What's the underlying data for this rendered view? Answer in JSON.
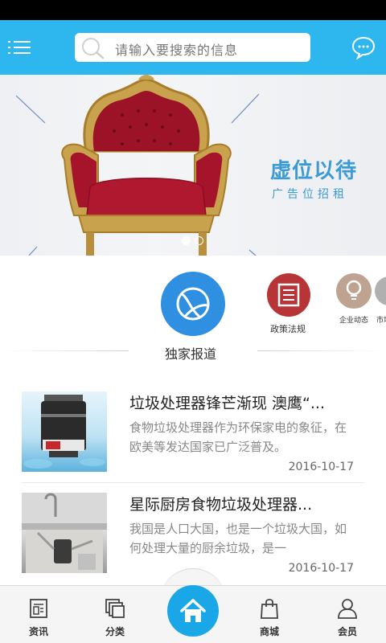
{
  "search": {
    "placeholder": "请输入要搜索的信息"
  },
  "banner": {
    "title": "虚位以待",
    "subtitle": "广告位招租",
    "slide_count": 2,
    "active_slide": 1
  },
  "categories": [
    {
      "label": "",
      "icon": "basketball-icon",
      "color": "#2f8fe0"
    },
    {
      "label": "政策法规",
      "icon": "document-icon",
      "color": "#b73437"
    },
    {
      "label": "企业动态",
      "icon": "lightbulb-icon",
      "color": "#bfa391"
    },
    {
      "label": "市场",
      "icon": "unknown-icon",
      "color": "#b0b0b0"
    }
  ],
  "section": {
    "title": "独家报道"
  },
  "news": [
    {
      "title": "垃圾处理器锋芒渐现 澳鹰“...",
      "desc": "食物垃圾处理器作为环保家电的象征，在欧美等发达国家已广泛普及。",
      "date": "2016-10-17"
    },
    {
      "title": "星际厨房食物垃圾处理器...",
      "desc": "我国是人口大国，也是一个垃圾大国，如何处理大量的厨余垃圾，是一",
      "date": "2016-10-17"
    }
  ],
  "tabs": [
    {
      "label": "资讯",
      "icon": "news-icon"
    },
    {
      "label": "分类",
      "icon": "category-icon"
    },
    {
      "label": "",
      "icon": "home-icon"
    },
    {
      "label": "商城",
      "icon": "shopping-bag-icon"
    },
    {
      "label": "会员",
      "icon": "user-icon"
    }
  ],
  "colors": {
    "header": "#2eb7ee",
    "accent": "#1aa7e8",
    "banner_text": "#3c9ad6"
  }
}
